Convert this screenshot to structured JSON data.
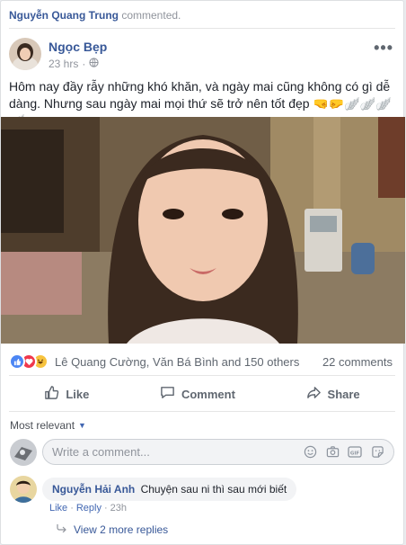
{
  "activity": {
    "actor": "Nguyễn Quang Trung",
    "action": "commented."
  },
  "post": {
    "author": "Ngọc Bẹp",
    "time": "23 hrs",
    "separator": "·",
    "privacy_icon": "globe-icon",
    "more_label": "•••",
    "text": "Hôm nay đầy rẫy những khó khăn, và ngày mai cũng không có gì dễ dàng. Nhưng sau ngày mai mọi thứ sẽ trở nên tốt đẹp 🤜🤛🪽🪽🪽🪽"
  },
  "reactions": {
    "icons": [
      "like-icon",
      "love-icon",
      "haha-icon"
    ],
    "names": "Lê Quang Cường, Văn Bá Bình and 150 others",
    "comments_count": "22 comments"
  },
  "actions": {
    "like": "Like",
    "comment": "Comment",
    "share": "Share"
  },
  "comments_section": {
    "sort_label": "Most relevant",
    "compose_placeholder": "Write a comment...",
    "compose_icons": [
      "emoji-icon",
      "camera-icon",
      "gif-icon",
      "sticker-icon"
    ]
  },
  "comment": {
    "author": "Nguyễn Hải Anh",
    "text": "Chuyện sau ni thì sau mới biết",
    "like": "Like",
    "dot": "·",
    "reply": "Reply",
    "time": "23h",
    "view_replies": "View 2 more replies"
  },
  "colors": {
    "link": "#385898",
    "accent": "#4267b2",
    "muted": "#90949c"
  }
}
